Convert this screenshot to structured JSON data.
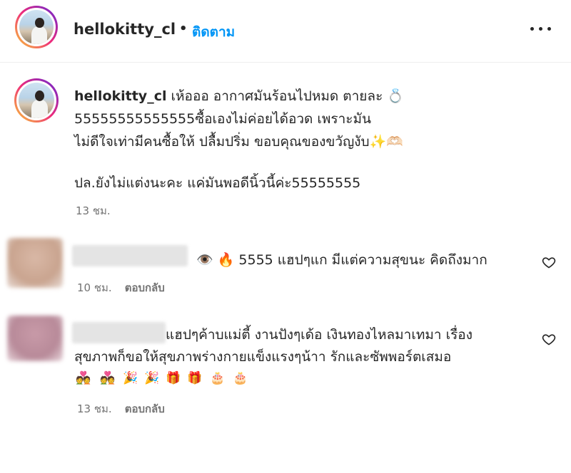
{
  "header": {
    "username": "hellokitty_cl",
    "dot": "•",
    "follow_label": "ติดตาม",
    "more_icon": "more-horizontal-icon"
  },
  "caption": {
    "username": "hellokitty_cl",
    "lines": [
      "เห้อออ อากาศมันร้อนไปหมด ตายละ 💍",
      "55555555555555ซื้อเองไม่ค่อยได้อวด เพราะมัน",
      "ไม่ดีใจเท่ามีคนซื้อให้ ปลื้มปริ่ม ขอบคุณของขวัญงับ✨🫶🏻",
      "ปล.ยังไม่แต่งนะคะ แค่มันพอดีนิ้วนี้ค่ะ55555555"
    ],
    "time": "13 ชม."
  },
  "comments": [
    {
      "text": "👁️ 🔥 5555 แฮปๆแก มีแต่ความสุขนะ คิดถึงมาก",
      "time": "10 ชม.",
      "reply_label": "ตอบกลับ"
    },
    {
      "lines": [
        "แฮปๆค้าบแม่ตี้ งานปังๆเด้อ เงินทองไหลมาเทมา เรื่อง",
        "สุขภาพก็ขอให้สุขภาพร่างกายแข็งแรงๆน้าา รักและซัพพอร์ตเสมอ"
      ],
      "emojis": [
        "💑",
        "💑",
        "🎉",
        "🎉",
        "🎁",
        "🎁",
        "🎂",
        "🎂"
      ],
      "time": "13 ชม.",
      "reply_label": "ตอบกลับ"
    }
  ],
  "icons": {
    "like": "heart-outline-icon"
  }
}
